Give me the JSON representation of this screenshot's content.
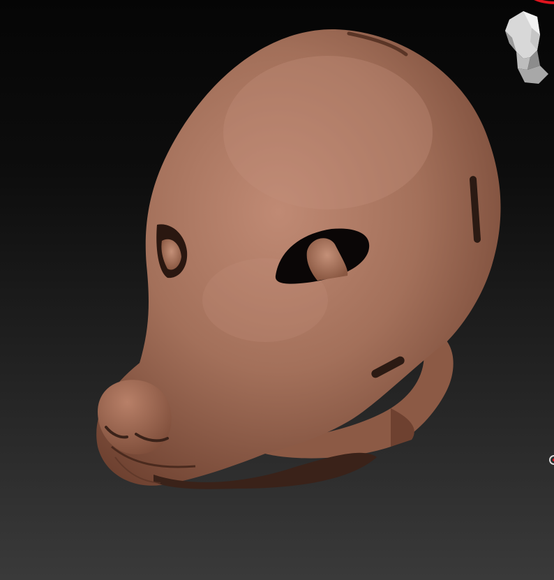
{
  "app": {
    "viewport_label": "",
    "model": {
      "subject": "dog-head-mask",
      "material_color": "#a0705a",
      "highlight_color": "#b98570",
      "shadow_color": "#5a3526"
    },
    "background": {
      "top_color": "#050505",
      "bottom_color": "#3a3a3a"
    },
    "icons": {
      "navigation": "head-orientation-icon",
      "marker": "red-arc-indicator"
    },
    "accent_color": "#e0141e"
  }
}
